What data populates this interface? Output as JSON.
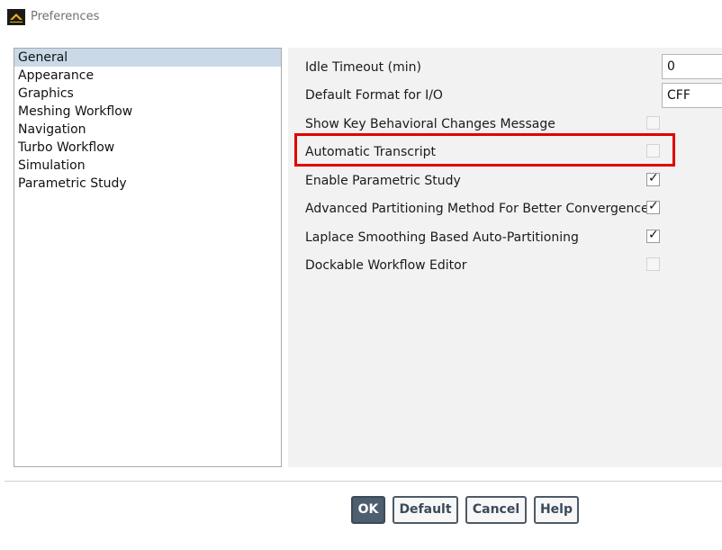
{
  "window": {
    "title": "Preferences"
  },
  "categories": [
    {
      "label": "General",
      "selected": true
    },
    {
      "label": "Appearance",
      "selected": false
    },
    {
      "label": "Graphics",
      "selected": false
    },
    {
      "label": "Meshing Workflow",
      "selected": false
    },
    {
      "label": "Navigation",
      "selected": false
    },
    {
      "label": "Turbo Workflow",
      "selected": false
    },
    {
      "label": "Simulation",
      "selected": false
    },
    {
      "label": "Parametric Study",
      "selected": false
    }
  ],
  "settings": {
    "idle_timeout": {
      "label": "Idle Timeout (min)",
      "value": "0"
    },
    "default_format": {
      "label": "Default Format for I/O",
      "value": "CFF"
    },
    "show_key_changes": {
      "label": "Show Key Behavioral Changes Message",
      "checked": false,
      "enabled": false
    },
    "automatic_transcript": {
      "label": "Automatic Transcript",
      "checked": false,
      "enabled": false
    },
    "enable_parametric": {
      "label": "Enable Parametric Study",
      "checked": true,
      "enabled": true
    },
    "advanced_partitioning": {
      "label": "Advanced Partitioning Method For Better Convergence",
      "checked": true,
      "enabled": true
    },
    "laplace_smoothing": {
      "label": "Laplace Smoothing Based Auto-Partitioning",
      "checked": true,
      "enabled": true
    },
    "dockable_editor": {
      "label": "Dockable Workflow Editor",
      "checked": false,
      "enabled": false
    }
  },
  "buttons": {
    "ok": "OK",
    "default": "Default",
    "cancel": "Cancel",
    "help": "Help"
  },
  "colors": {
    "highlight": "#e00000",
    "selection": "#c9d9e8",
    "primary_button": "#4c5e6f"
  }
}
